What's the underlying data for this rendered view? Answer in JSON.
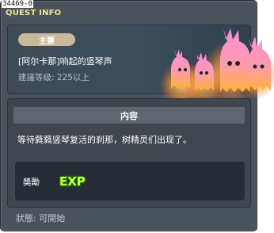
{
  "quest": {
    "id": "34469-0",
    "window_title": "QUEST INFO",
    "category_tag": "主要",
    "name": "[阿尔卡那]响起的竖琴声",
    "level_requirement": "建議等级: 225以上"
  },
  "content": {
    "header": "内容",
    "description": "等待蕤蕤竖琴复活的刹那，树精灵们出现了。"
  },
  "reward": {
    "label": "奬勵",
    "exp_text": "EXP"
  },
  "status": "狀態:  可開始",
  "colors": {
    "title": "#f2e38a",
    "window_bg": "#4a535c",
    "tag_bg": "#c9b89a",
    "exp_fill": "#c6ff3a",
    "ghost_pink": "#ff7ad0",
    "ghost_orange": "#ffb000"
  }
}
